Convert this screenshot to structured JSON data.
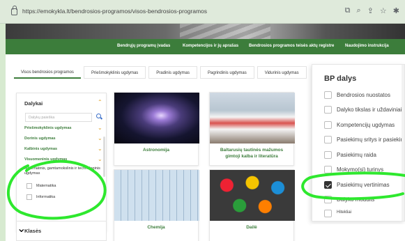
{
  "browser": {
    "url": "https://emokykla.lt/bendrosios-programos/visos-bendrosios-programos"
  },
  "nav": {
    "items": [
      "Bendrųjų programų įvadas",
      "Kompetencijos ir jų aprašas",
      "Bendrosios programos teisės aktų registre",
      "Naudojimo instrukcija"
    ]
  },
  "tabs": [
    "Visos bendrosios programos",
    "Priešmokyklinis ugdymas",
    "Pradinis ugdymas",
    "Pagrindinis ugdymas",
    "Vidurinis ugdymas"
  ],
  "filter": {
    "title": "Dalykai",
    "search_placeholder": "Dalykų paieška",
    "groups": [
      "Priešmokyklinis ugdymas",
      "Dorinis ugdymas",
      "Kalbinis ugdymas",
      "Visuomeninis ugdymas"
    ],
    "open_group": "Matematinis, gamtamokslinis ir technologinis ugdymas",
    "options": [
      "Matematika",
      "Informatika"
    ],
    "second_title": "Klasės"
  },
  "cards": [
    "Astronomija",
    "Baltarusių tautinės mažumos gimtoji kalba ir literatūra",
    "Chemija",
    "Dailė"
  ],
  "bp_panel": {
    "title": "BP dalys",
    "items": [
      {
        "label": "Bendrosios nuostatos",
        "checked": false
      },
      {
        "label": "Dalyko tikslas ir uždaviniai",
        "checked": false
      },
      {
        "label": "Kompetencijų ugdymas",
        "checked": false
      },
      {
        "label": "Pasiekimų sritys ir pasiekimai",
        "checked": false
      },
      {
        "label": "Pasiekimų raida",
        "checked": false
      },
      {
        "label": "Mokymo(si) turinys",
        "checked": false
      },
      {
        "label": "Pasiekimų vertinimas",
        "checked": true
      },
      {
        "label": "Dalyko modulis",
        "checked": false
      },
      {
        "label": "Hitekliai",
        "checked": false
      }
    ]
  },
  "colors": {
    "accent": "#3c7d3b",
    "annotation": "#2ee82e",
    "chevron": "#e0a020"
  }
}
